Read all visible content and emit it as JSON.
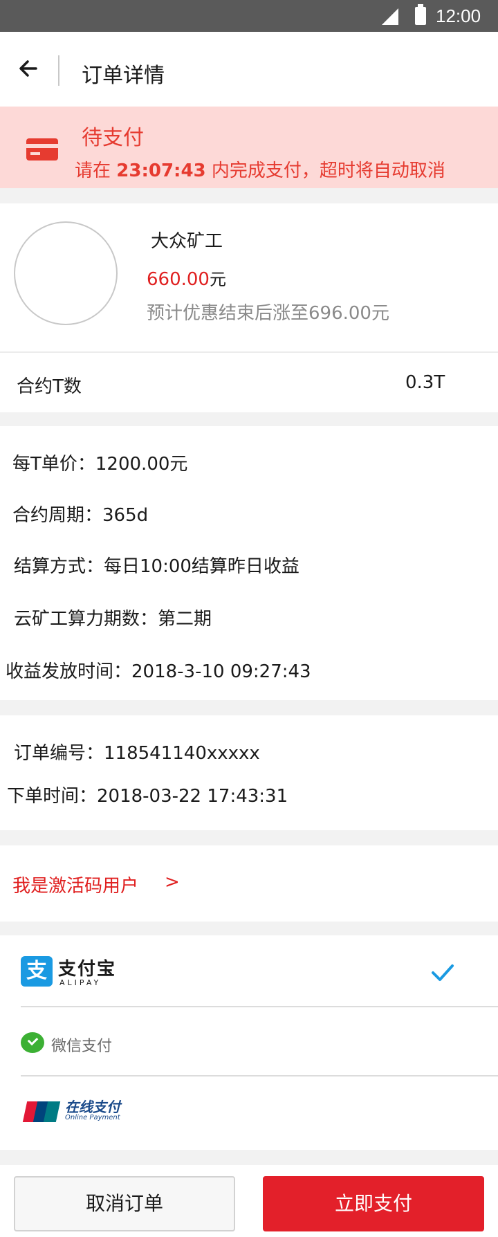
{
  "status_bar": {
    "time": "12:00"
  },
  "header": {
    "title": "订单详情"
  },
  "pending": {
    "title": "待支付",
    "msg_prefix": "请在",
    "countdown": "23:07:43",
    "msg_suffix": "内完成支付，超时将自动取消"
  },
  "product": {
    "name": "大众矿工",
    "price": "660.00",
    "price_unit": "元",
    "note": "预计优惠结束后涨至696.00元"
  },
  "contract": {
    "label": "合约T数",
    "value": "0.3T"
  },
  "details": {
    "unit_price": "每T单价：1200.00元",
    "period": "合约周期：365d",
    "settlement": "结算方式：每日10:00结算昨日收益",
    "phase": "云矿工算力期数：第二期",
    "payout_time": "收益发放时间：2018-3-10 09:27:43"
  },
  "order": {
    "number": "订单编号：118541140xxxxx",
    "time": "下单时间：2018-03-22  17:43:31"
  },
  "activation": {
    "label": "我是激活码用户",
    "arrow": ">"
  },
  "payments": {
    "alipay": {
      "logo_char": "支",
      "name": "支付宝",
      "sub": "ALIPAY",
      "selected": true
    },
    "wechat": {
      "name": "微信支付"
    },
    "unionpay": {
      "name": "在线支付",
      "sub": "Online Payment"
    }
  },
  "colors": {
    "accent": "#e3202a",
    "pending_bg": "#fdd9d7",
    "check": "#1a9ae2"
  },
  "actions": {
    "cancel": "取消订单",
    "pay": "立即支付"
  }
}
